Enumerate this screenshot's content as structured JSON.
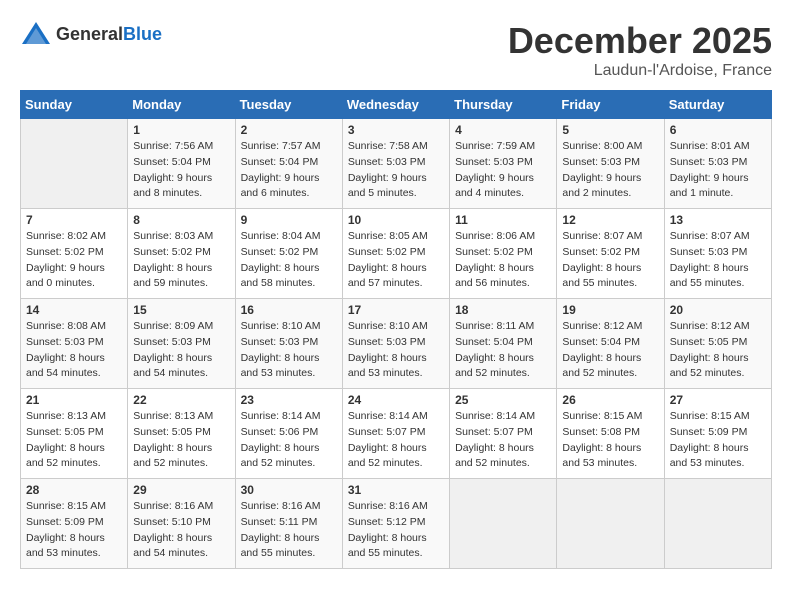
{
  "header": {
    "logo_general": "General",
    "logo_blue": "Blue",
    "month": "December 2025",
    "location": "Laudun-l'Ardoise, France"
  },
  "weekdays": [
    "Sunday",
    "Monday",
    "Tuesday",
    "Wednesday",
    "Thursday",
    "Friday",
    "Saturday"
  ],
  "weeks": [
    [
      {
        "day": "",
        "info": ""
      },
      {
        "day": "1",
        "info": "Sunrise: 7:56 AM\nSunset: 5:04 PM\nDaylight: 9 hours\nand 8 minutes."
      },
      {
        "day": "2",
        "info": "Sunrise: 7:57 AM\nSunset: 5:04 PM\nDaylight: 9 hours\nand 6 minutes."
      },
      {
        "day": "3",
        "info": "Sunrise: 7:58 AM\nSunset: 5:03 PM\nDaylight: 9 hours\nand 5 minutes."
      },
      {
        "day": "4",
        "info": "Sunrise: 7:59 AM\nSunset: 5:03 PM\nDaylight: 9 hours\nand 4 minutes."
      },
      {
        "day": "5",
        "info": "Sunrise: 8:00 AM\nSunset: 5:03 PM\nDaylight: 9 hours\nand 2 minutes."
      },
      {
        "day": "6",
        "info": "Sunrise: 8:01 AM\nSunset: 5:03 PM\nDaylight: 9 hours\nand 1 minute."
      }
    ],
    [
      {
        "day": "7",
        "info": "Sunrise: 8:02 AM\nSunset: 5:02 PM\nDaylight: 9 hours\nand 0 minutes."
      },
      {
        "day": "8",
        "info": "Sunrise: 8:03 AM\nSunset: 5:02 PM\nDaylight: 8 hours\nand 59 minutes."
      },
      {
        "day": "9",
        "info": "Sunrise: 8:04 AM\nSunset: 5:02 PM\nDaylight: 8 hours\nand 58 minutes."
      },
      {
        "day": "10",
        "info": "Sunrise: 8:05 AM\nSunset: 5:02 PM\nDaylight: 8 hours\nand 57 minutes."
      },
      {
        "day": "11",
        "info": "Sunrise: 8:06 AM\nSunset: 5:02 PM\nDaylight: 8 hours\nand 56 minutes."
      },
      {
        "day": "12",
        "info": "Sunrise: 8:07 AM\nSunset: 5:02 PM\nDaylight: 8 hours\nand 55 minutes."
      },
      {
        "day": "13",
        "info": "Sunrise: 8:07 AM\nSunset: 5:03 PM\nDaylight: 8 hours\nand 55 minutes."
      }
    ],
    [
      {
        "day": "14",
        "info": "Sunrise: 8:08 AM\nSunset: 5:03 PM\nDaylight: 8 hours\nand 54 minutes."
      },
      {
        "day": "15",
        "info": "Sunrise: 8:09 AM\nSunset: 5:03 PM\nDaylight: 8 hours\nand 54 minutes."
      },
      {
        "day": "16",
        "info": "Sunrise: 8:10 AM\nSunset: 5:03 PM\nDaylight: 8 hours\nand 53 minutes."
      },
      {
        "day": "17",
        "info": "Sunrise: 8:10 AM\nSunset: 5:03 PM\nDaylight: 8 hours\nand 53 minutes."
      },
      {
        "day": "18",
        "info": "Sunrise: 8:11 AM\nSunset: 5:04 PM\nDaylight: 8 hours\nand 52 minutes."
      },
      {
        "day": "19",
        "info": "Sunrise: 8:12 AM\nSunset: 5:04 PM\nDaylight: 8 hours\nand 52 minutes."
      },
      {
        "day": "20",
        "info": "Sunrise: 8:12 AM\nSunset: 5:05 PM\nDaylight: 8 hours\nand 52 minutes."
      }
    ],
    [
      {
        "day": "21",
        "info": "Sunrise: 8:13 AM\nSunset: 5:05 PM\nDaylight: 8 hours\nand 52 minutes."
      },
      {
        "day": "22",
        "info": "Sunrise: 8:13 AM\nSunset: 5:05 PM\nDaylight: 8 hours\nand 52 minutes."
      },
      {
        "day": "23",
        "info": "Sunrise: 8:14 AM\nSunset: 5:06 PM\nDaylight: 8 hours\nand 52 minutes."
      },
      {
        "day": "24",
        "info": "Sunrise: 8:14 AM\nSunset: 5:07 PM\nDaylight: 8 hours\nand 52 minutes."
      },
      {
        "day": "25",
        "info": "Sunrise: 8:14 AM\nSunset: 5:07 PM\nDaylight: 8 hours\nand 52 minutes."
      },
      {
        "day": "26",
        "info": "Sunrise: 8:15 AM\nSunset: 5:08 PM\nDaylight: 8 hours\nand 53 minutes."
      },
      {
        "day": "27",
        "info": "Sunrise: 8:15 AM\nSunset: 5:09 PM\nDaylight: 8 hours\nand 53 minutes."
      }
    ],
    [
      {
        "day": "28",
        "info": "Sunrise: 8:15 AM\nSunset: 5:09 PM\nDaylight: 8 hours\nand 53 minutes."
      },
      {
        "day": "29",
        "info": "Sunrise: 8:16 AM\nSunset: 5:10 PM\nDaylight: 8 hours\nand 54 minutes."
      },
      {
        "day": "30",
        "info": "Sunrise: 8:16 AM\nSunset: 5:11 PM\nDaylight: 8 hours\nand 55 minutes."
      },
      {
        "day": "31",
        "info": "Sunrise: 8:16 AM\nSunset: 5:12 PM\nDaylight: 8 hours\nand 55 minutes."
      },
      {
        "day": "",
        "info": ""
      },
      {
        "day": "",
        "info": ""
      },
      {
        "day": "",
        "info": ""
      }
    ]
  ]
}
